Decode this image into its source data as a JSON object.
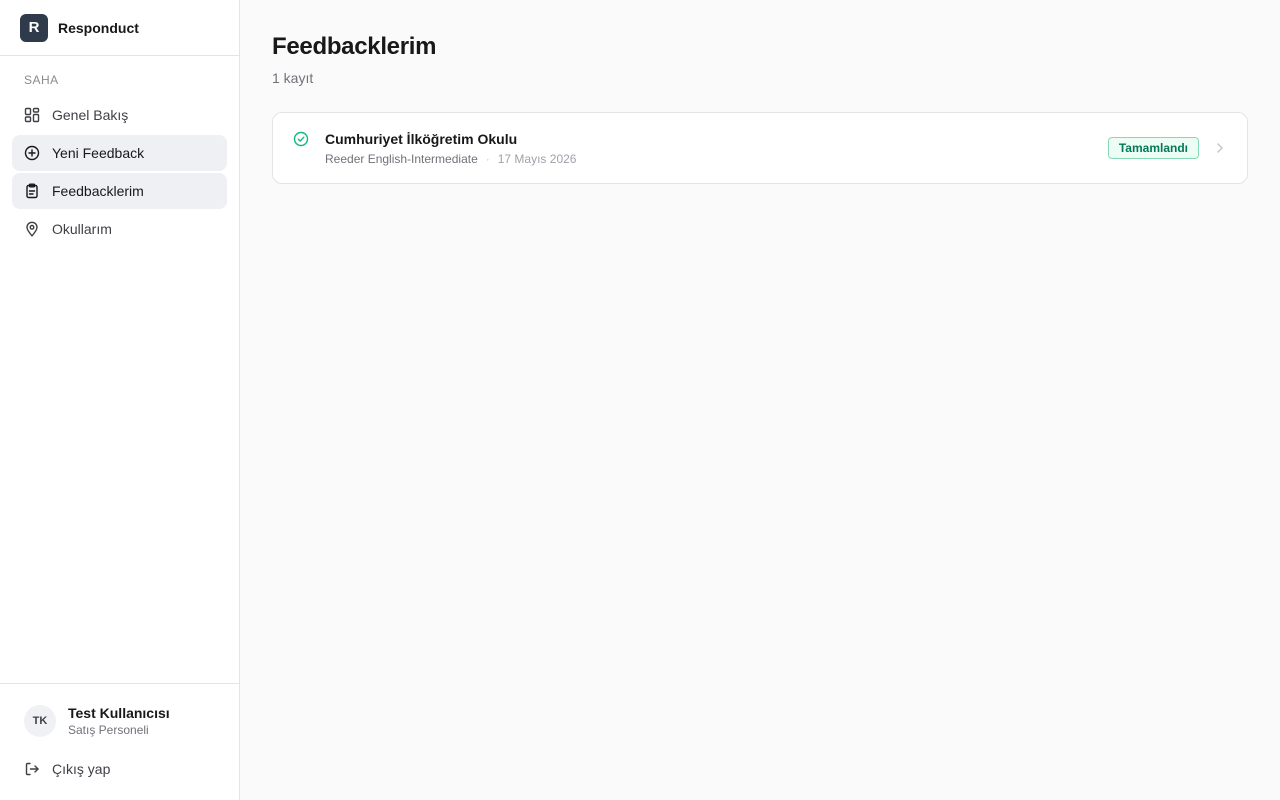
{
  "brand": {
    "logo_letter": "R",
    "name": "Responduct",
    "color": "#2f3a4a"
  },
  "sidebar": {
    "section_label": "SAHA",
    "items": [
      {
        "label": "Genel Bakış",
        "icon": "dashboard-grid-icon"
      },
      {
        "label": "Yeni Feedback",
        "icon": "plus-circle-icon"
      },
      {
        "label": "Feedbacklerim",
        "icon": "clipboard-icon"
      },
      {
        "label": "Okullarım",
        "icon": "map-pin-icon"
      }
    ]
  },
  "user": {
    "initials": "TK",
    "name": "Test Kullanıcısı",
    "role": "Satış Personeli"
  },
  "logout": {
    "label": "Çıkış yap",
    "icon": "logout-icon"
  },
  "page": {
    "title": "Feedbacklerim",
    "count": "1 kayıt"
  },
  "feedbacks": [
    {
      "school": "Cumhuriyet İlköğretim Okulu",
      "product": "Reeder English-Intermediate",
      "separator": "·",
      "date": "17 Mayıs 2026",
      "status": "Tamamlandı",
      "status_color": "#047857",
      "icon": "check-circle-icon"
    }
  ]
}
